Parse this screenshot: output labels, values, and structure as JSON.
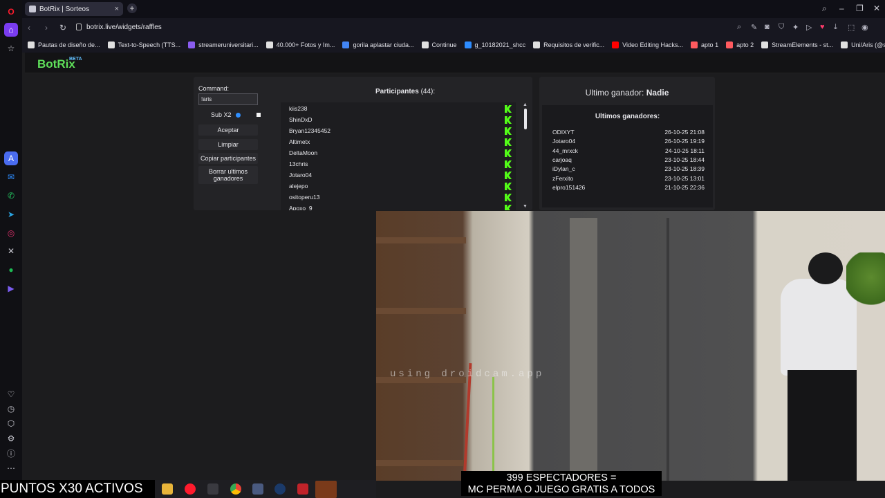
{
  "browser": {
    "tab_title": "BotRix | Sorteos",
    "url": "botrix.live/widgets/raffles",
    "bookmarks": [
      {
        "label": "Pautas de diseño de...",
        "icon": "bookmark-icon"
      },
      {
        "label": "Text-to-Speech (TTS...",
        "icon": "bookmark-icon"
      },
      {
        "label": "streameruniversitari...",
        "icon": "bookmark-icon"
      },
      {
        "label": "40.000+ Fotos y Im...",
        "icon": "bookmark-icon"
      },
      {
        "label": "gorila aplastar ciuda...",
        "icon": "google-icon"
      },
      {
        "label": "Continue",
        "icon": "bookmark-icon"
      },
      {
        "label": "g_10182021_shcc",
        "icon": "bookmark-icon"
      },
      {
        "label": "Requisitos de verific...",
        "icon": "x-icon"
      },
      {
        "label": "Video Editing Hacks...",
        "icon": "youtube-icon"
      },
      {
        "label": "apto 1",
        "icon": "airbnb-icon"
      },
      {
        "label": "apto 2",
        "icon": "airbnb-icon"
      },
      {
        "label": "StreamElements - st...",
        "icon": "bookmark-icon"
      },
      {
        "label": "Uni/Aris (@streame...",
        "icon": "tiktok-icon"
      }
    ]
  },
  "botrix": {
    "logo": "BotRix",
    "badge": "BETA",
    "command_label": "Command:",
    "command_value": "!aris",
    "sub_label": "Sub X2",
    "buttons": {
      "accept": "Aceptar",
      "clear": "Limpiar",
      "copy": "Copiar participantes",
      "delete_winners": "Borrar ultimos ganadores"
    },
    "participants_title": "Participantes",
    "participants_count": "(44)",
    "participants_colon": ":",
    "participants": [
      "kiis238",
      "ShinDxD",
      "Bryan12345452",
      "Altimetx",
      "DeltaMoon",
      "13chris",
      "Jotaro04",
      "alejepo",
      "ositoperu13",
      "Apoxo_9"
    ],
    "last_winner_label": "Ultimo ganador:",
    "last_winner_name": "Nadie",
    "recent_winners_title": "Ultimos ganadores:",
    "recent_winners": [
      {
        "name": "ODIXYT",
        "date": "26-10-25 21:08"
      },
      {
        "name": "Jotaro04",
        "date": "26-10-25 19:19"
      },
      {
        "name": "44_mrxck",
        "date": "24-10-25 18:11"
      },
      {
        "name": "carjoaq",
        "date": "23-10-25 18:44"
      },
      {
        "name": "iDylan_c",
        "date": "23-10-25 18:39"
      },
      {
        "name": "zFerxito",
        "date": "23-10-25 13:01"
      },
      {
        "name": "elpro151426",
        "date": "21-10-25 22:36"
      }
    ]
  },
  "overlay": {
    "watermark": "using droidcam.app",
    "viewers_line1": "399 ESPECTADORES =",
    "viewers_line2": "MC PERMA O JUEGO GRATIS A TODOS",
    "puntos": "PUNTOS X30 ACTIVOS"
  },
  "colors": {
    "accent_green": "#53fc18",
    "logo_green": "#5fe05a",
    "opera_red": "#ff1b2d"
  }
}
